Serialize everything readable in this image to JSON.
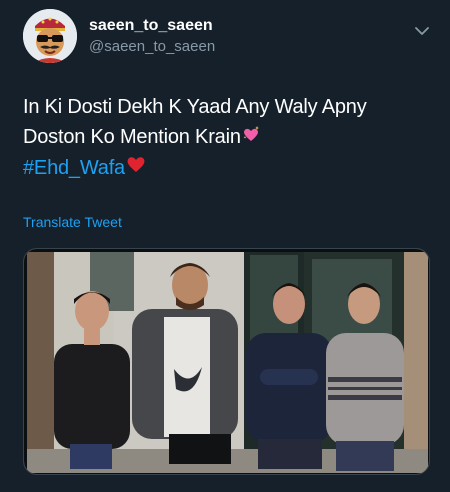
{
  "author": {
    "display_name": "saeen_to_saeen",
    "handle": "@saeen_to_saeen",
    "avatar_icon": "cartoon-avatar-icon"
  },
  "header": {
    "menu_icon": "chevron-down-icon"
  },
  "tweet": {
    "line1": "In Ki Dosti Dekh K Yaad Any Waly Apny",
    "line2": "Doston Ko Mention Krain",
    "line2_emoji": "sparkling-heart-emoji",
    "hashtag": "#Ehd_Wafa",
    "hashtag_emoji": "red-heart-emoji"
  },
  "translate_label": "Translate Tweet",
  "media": {
    "description_icon": "group-photo-four-men"
  },
  "colors": {
    "background": "#15202b",
    "text_primary": "#ffffff",
    "text_secondary": "#8899a6",
    "accent": "#1da1f2"
  }
}
